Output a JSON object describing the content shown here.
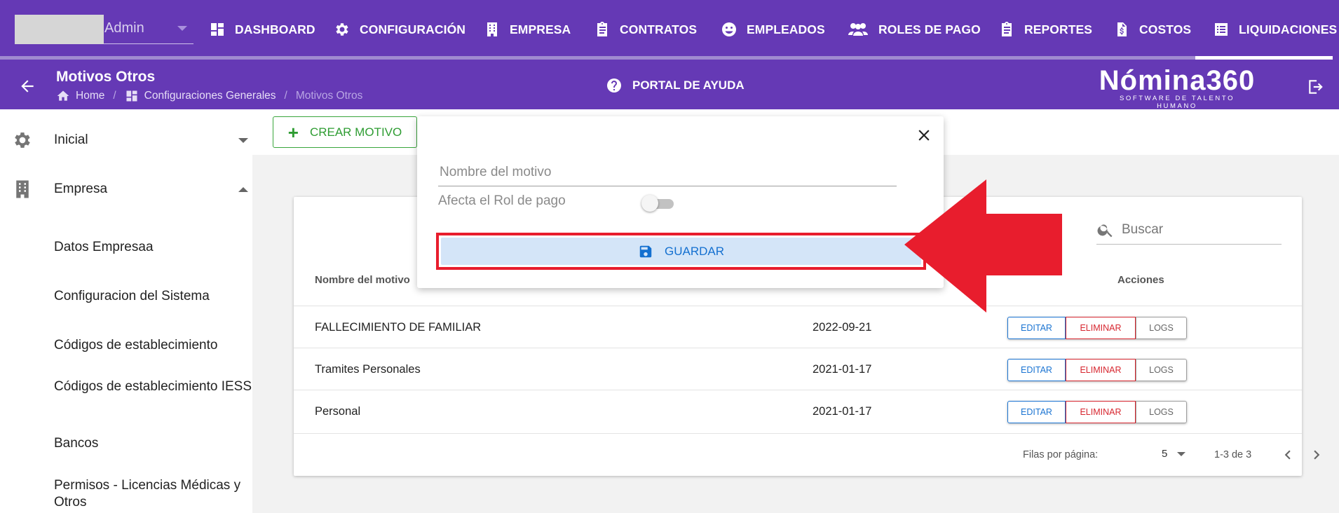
{
  "user": {
    "name": "Admin"
  },
  "nav": {
    "items": [
      {
        "label": "DASHBOARD",
        "icon": "dashboard-icon"
      },
      {
        "label": "CONFIGURACIÓN",
        "icon": "gear-icon"
      },
      {
        "label": "EMPRESA",
        "icon": "building-icon"
      },
      {
        "label": "CONTRATOS",
        "icon": "clipboard-icon"
      },
      {
        "label": "EMPLEADOS",
        "icon": "face-icon"
      },
      {
        "label": "ROLES DE PAGO",
        "icon": "people-icon"
      },
      {
        "label": "REPORTES",
        "icon": "clipboard-icon"
      },
      {
        "label": "COSTOS",
        "icon": "dollar-file-icon"
      },
      {
        "label": "LIQUIDACIONES",
        "icon": "list-icon"
      }
    ],
    "active": "LIQUIDACIONES"
  },
  "header": {
    "title": "Motivos Otros",
    "breadcrumb": [
      "Home",
      "Configuraciones Generales",
      "Motivos Otros"
    ],
    "help_label": "PORTAL DE AYUDA",
    "brand_name": "Nómina360",
    "brand_tagline": "SOFTWARE DE TALENTO HUMANO"
  },
  "sidebar": {
    "groups": [
      {
        "label": "Inicial",
        "icon": "gear-icon",
        "expanded": false
      },
      {
        "label": "Empresa",
        "icon": "building-icon",
        "expanded": true
      }
    ],
    "items": [
      "Datos Empresaa",
      "Configuracion del Sistema",
      "Códigos de establecimiento",
      "Códigos de establecimiento IESS",
      "Bancos",
      "Permisos - Licencias Médicas y Otros"
    ]
  },
  "main": {
    "create_label": "CREAR MOTIVO",
    "search_placeholder": "Buscar",
    "columns": {
      "name": "Nombre del motivo",
      "actions": "Acciones"
    },
    "rows": [
      {
        "name": "FALLECIMIENTO DE FAMILIAR",
        "date": "2022-09-21"
      },
      {
        "name": "Tramites Personales",
        "date": "2021-01-17"
      },
      {
        "name": "Personal",
        "date": "2021-01-17"
      }
    ],
    "actions": {
      "edit": "EDITAR",
      "delete": "ELIMINAR",
      "logs": "LOGS"
    },
    "pagination": {
      "rows_label": "Filas por página:",
      "rows_value": "5",
      "range": "1-3 de 3"
    }
  },
  "popup": {
    "name_placeholder": "Nombre del motivo",
    "toggle_label": "Afecta el Rol de pago",
    "toggle_on": false,
    "save_label": "GUARDAR"
  },
  "colors": {
    "nav_bg": "#6539b5",
    "create_green": "#39a63c",
    "edit_blue": "#1b74d2",
    "delete_red": "#d7262f",
    "highlight_red": "#e81d2d"
  }
}
